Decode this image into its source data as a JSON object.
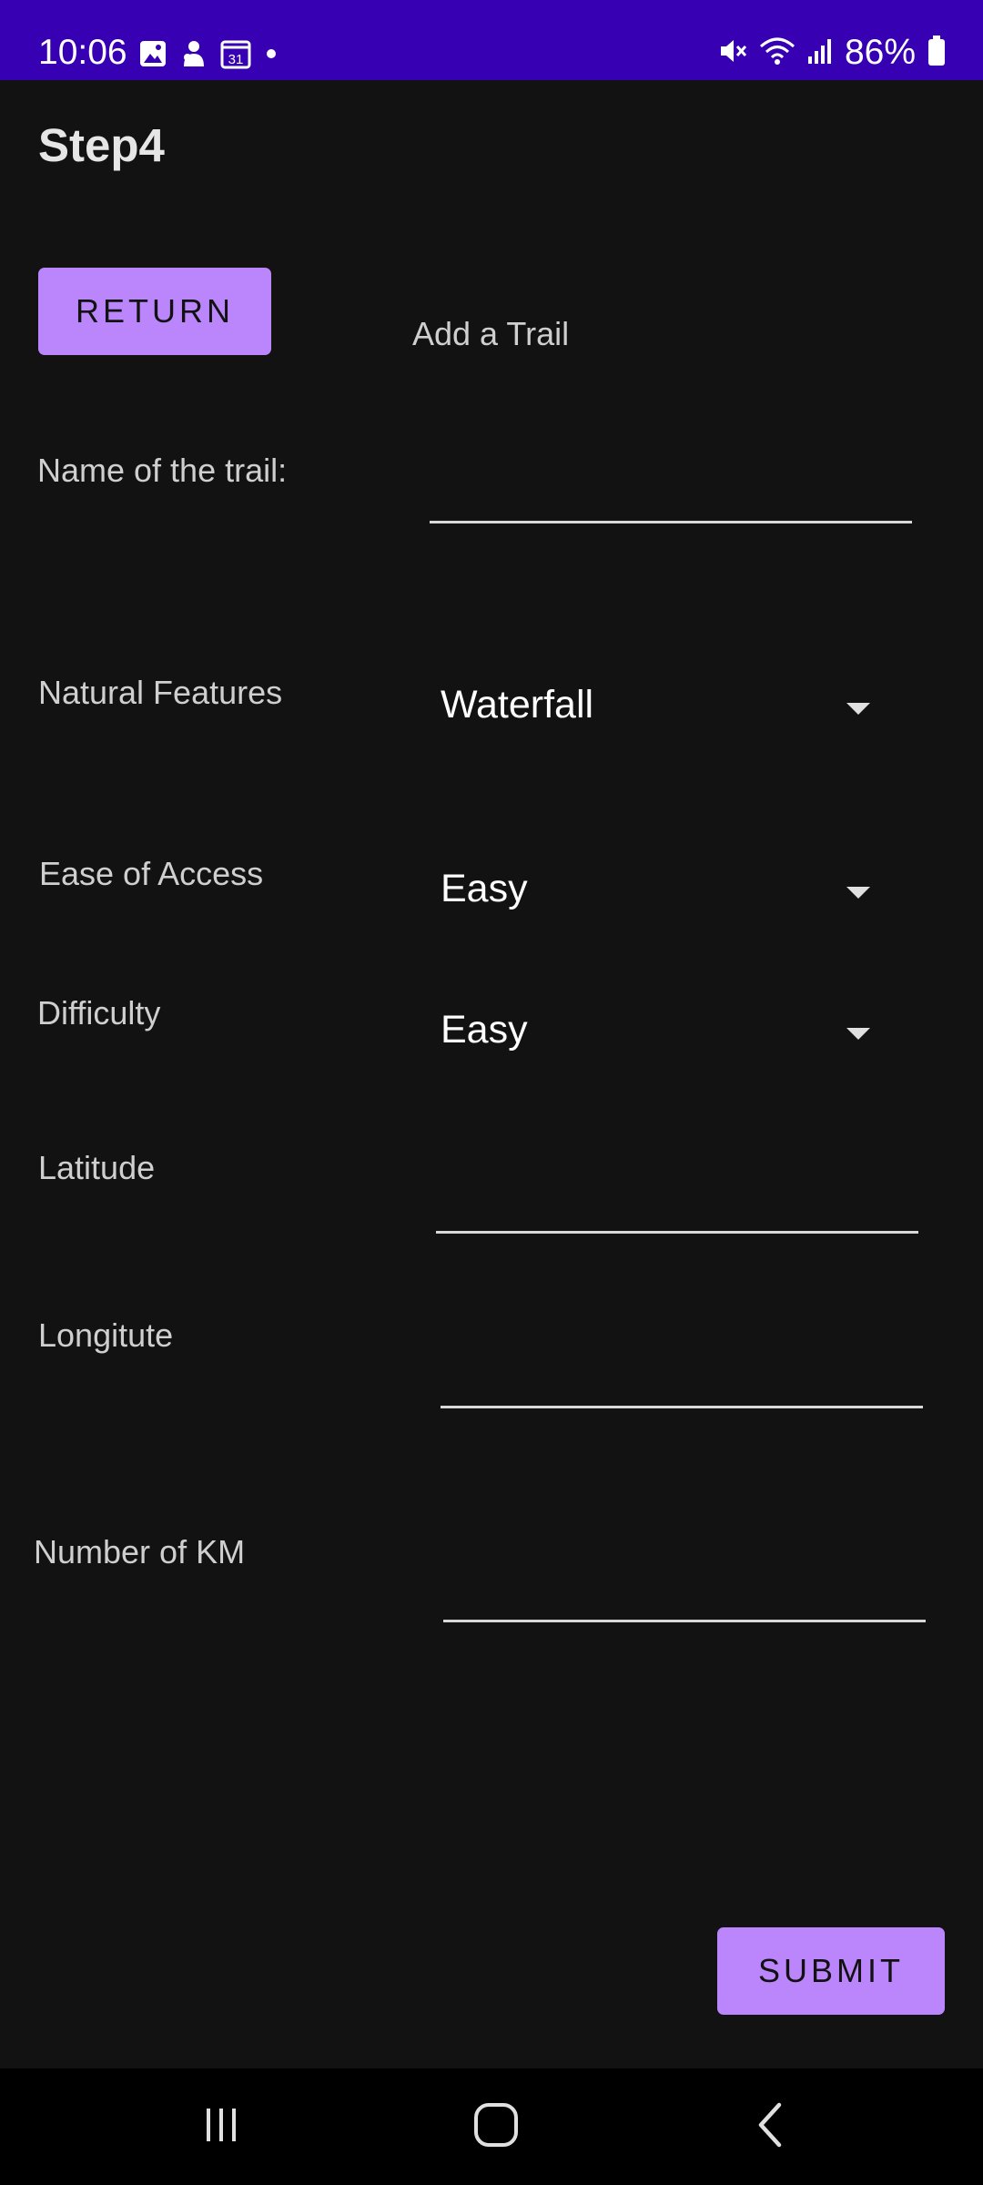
{
  "status_bar": {
    "time": "10:06",
    "battery": "86%",
    "left_icons": [
      "gallery-icon",
      "notification-app-icon",
      "calendar-icon",
      "dot-icon"
    ],
    "calendar_day": "31",
    "right_icons": [
      "mute-icon",
      "wifi-icon",
      "signal-icon",
      "battery-icon"
    ],
    "color": "#3700b3"
  },
  "app_bar": {
    "title": "Step4"
  },
  "top": {
    "return_label": "RETURN",
    "header": "Add a Trail"
  },
  "form": {
    "name_label": "Name of the trail:",
    "name_value": "",
    "features_label": "Natural Features",
    "features_value": "Waterfall",
    "access_label": "Ease of Access",
    "access_value": "Easy",
    "difficulty_label": "Difficulty",
    "difficulty_value": "Easy",
    "latitude_label": "Latitude",
    "latitude_value": "",
    "longitude_label": "Longitute",
    "longitude_value": "",
    "km_label": "Number of KM",
    "km_value": ""
  },
  "actions": {
    "submit_label": "SUBMIT"
  },
  "nav_bar": {
    "items": [
      "recent-apps-icon",
      "home-icon",
      "back-icon"
    ]
  },
  "colors": {
    "accent": "#bb86fc",
    "background": "#121212",
    "status_bar": "#3700b3"
  }
}
